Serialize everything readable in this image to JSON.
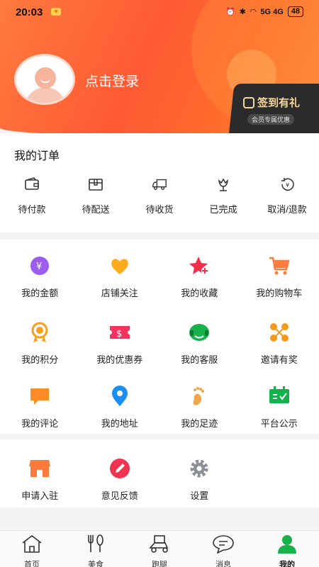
{
  "status": {
    "time": "20:03",
    "network": "5G 4G",
    "battery": "48"
  },
  "header": {
    "login_text": "点击登录",
    "signin_title": "签到有礼",
    "signin_sub": "会员专属优惠"
  },
  "orders": {
    "title": "我的订单",
    "items": [
      {
        "label": "待付款",
        "icon": "wallet-icon"
      },
      {
        "label": "待配送",
        "icon": "package-icon"
      },
      {
        "label": "待收货",
        "icon": "truck-icon"
      },
      {
        "label": "已完成",
        "icon": "flower-icon"
      },
      {
        "label": "取消/退款",
        "icon": "refund-icon"
      }
    ]
  },
  "services": {
    "rows": [
      [
        {
          "label": "我的金额",
          "icon": "money-icon"
        },
        {
          "label": "店铺关注",
          "icon": "heart-icon"
        },
        {
          "label": "我的收藏",
          "icon": "star-icon"
        },
        {
          "label": "我的购物车",
          "icon": "cart-icon"
        }
      ],
      [
        {
          "label": "我的积分",
          "icon": "medal-icon"
        },
        {
          "label": "我的优惠券",
          "icon": "coupon-icon"
        },
        {
          "label": "我的客服",
          "icon": "headset-icon"
        },
        {
          "label": "邀请有奖",
          "icon": "network-icon"
        }
      ],
      [
        {
          "label": "我的评论",
          "icon": "comment-icon"
        },
        {
          "label": "我的地址",
          "icon": "location-icon"
        },
        {
          "label": "我的足迹",
          "icon": "footprint-icon"
        },
        {
          "label": "平台公示",
          "icon": "notice-board-icon"
        }
      ]
    ]
  },
  "extras": [
    {
      "label": "申请入驻",
      "icon": "shop-icon"
    },
    {
      "label": "意见反馈",
      "icon": "feedback-icon"
    },
    {
      "label": "设置",
      "icon": "gear-icon"
    }
  ],
  "tabbar": [
    {
      "label": "首页",
      "icon": "home-icon"
    },
    {
      "label": "美食",
      "icon": "food-icon"
    },
    {
      "label": "跑腿",
      "icon": "delivery-icon"
    },
    {
      "label": "消息",
      "icon": "message-icon"
    },
    {
      "label": "我的",
      "icon": "profile-icon",
      "active": true
    }
  ],
  "colors": {
    "accent": "#ff5a34",
    "active_tab": "#19b24a"
  }
}
